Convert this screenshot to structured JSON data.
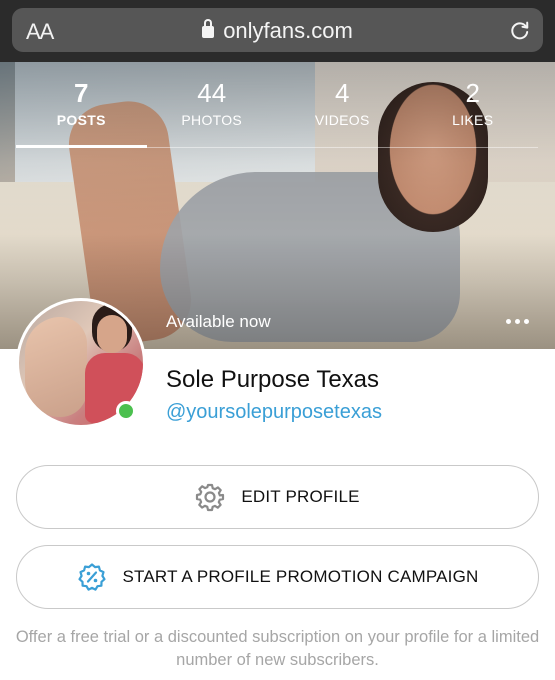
{
  "browser": {
    "text_size_button": "AA",
    "url": "onlyfans.com",
    "icons": {
      "lock": "lock-icon",
      "reload": "reload-icon"
    }
  },
  "profile": {
    "stats": [
      {
        "count": "7",
        "label": "POSTS",
        "active": true
      },
      {
        "count": "44",
        "label": "PHOTOS",
        "active": false
      },
      {
        "count": "4",
        "label": "VIDEOS",
        "active": false
      },
      {
        "count": "2",
        "label": "LIKES",
        "active": false
      }
    ],
    "availability": "Available now",
    "name": "Sole Purpose Texas",
    "handle": "@yoursolepurposetexas",
    "online_color": "#4cc04f"
  },
  "actions": {
    "edit_profile": "EDIT PROFILE",
    "promotion_campaign": "START A PROFILE PROMOTION CAMPAIGN",
    "promotion_note": "Offer a free trial or a discounted subscription on your profile for a limited number of new subscribers."
  },
  "colors": {
    "accent": "#3a9fd6",
    "icon_gray": "#8a8a8a",
    "note_text": "#a6a6a6"
  }
}
